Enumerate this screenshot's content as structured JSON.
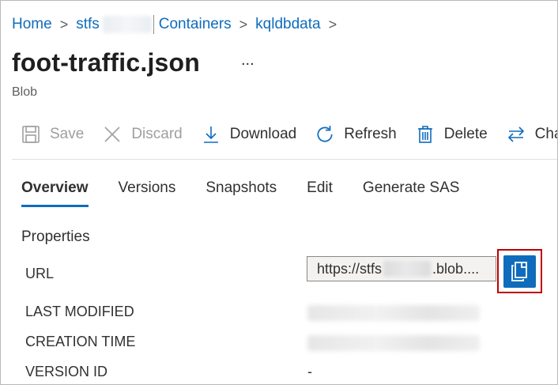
{
  "breadcrumb": {
    "items": [
      "Home",
      "stfs",
      "Containers",
      "kqldbdata"
    ],
    "separator": ">"
  },
  "header": {
    "title": "foot-traffic.json",
    "more_label": "...",
    "subtitle": "Blob"
  },
  "toolbar": {
    "save_label": "Save",
    "discard_label": "Discard",
    "download_label": "Download",
    "refresh_label": "Refresh",
    "delete_label": "Delete",
    "change_label": "Cha"
  },
  "tabs": [
    {
      "label": "Overview",
      "selected": true
    },
    {
      "label": "Versions",
      "selected": false
    },
    {
      "label": "Snapshots",
      "selected": false
    },
    {
      "label": "Edit",
      "selected": false
    },
    {
      "label": "Generate SAS",
      "selected": false
    }
  ],
  "properties": {
    "section_title": "Properties",
    "url_label": "URL",
    "url_prefix": "https://stfs",
    "url_suffix": ".blob....",
    "last_modified_label": "LAST MODIFIED",
    "creation_time_label": "CREATION TIME",
    "version_id_label": "VERSION ID",
    "version_id_value": "-"
  },
  "colors": {
    "accent": "#0f6cbd",
    "highlight_border": "#c00000",
    "disabled_text": "#a19f9d"
  },
  "icons": {
    "save": "save-icon",
    "discard": "close-icon",
    "download": "download-icon",
    "refresh": "refresh-icon",
    "delete": "trash-icon",
    "change": "swap-arrows-icon",
    "copy": "copy-icon"
  }
}
